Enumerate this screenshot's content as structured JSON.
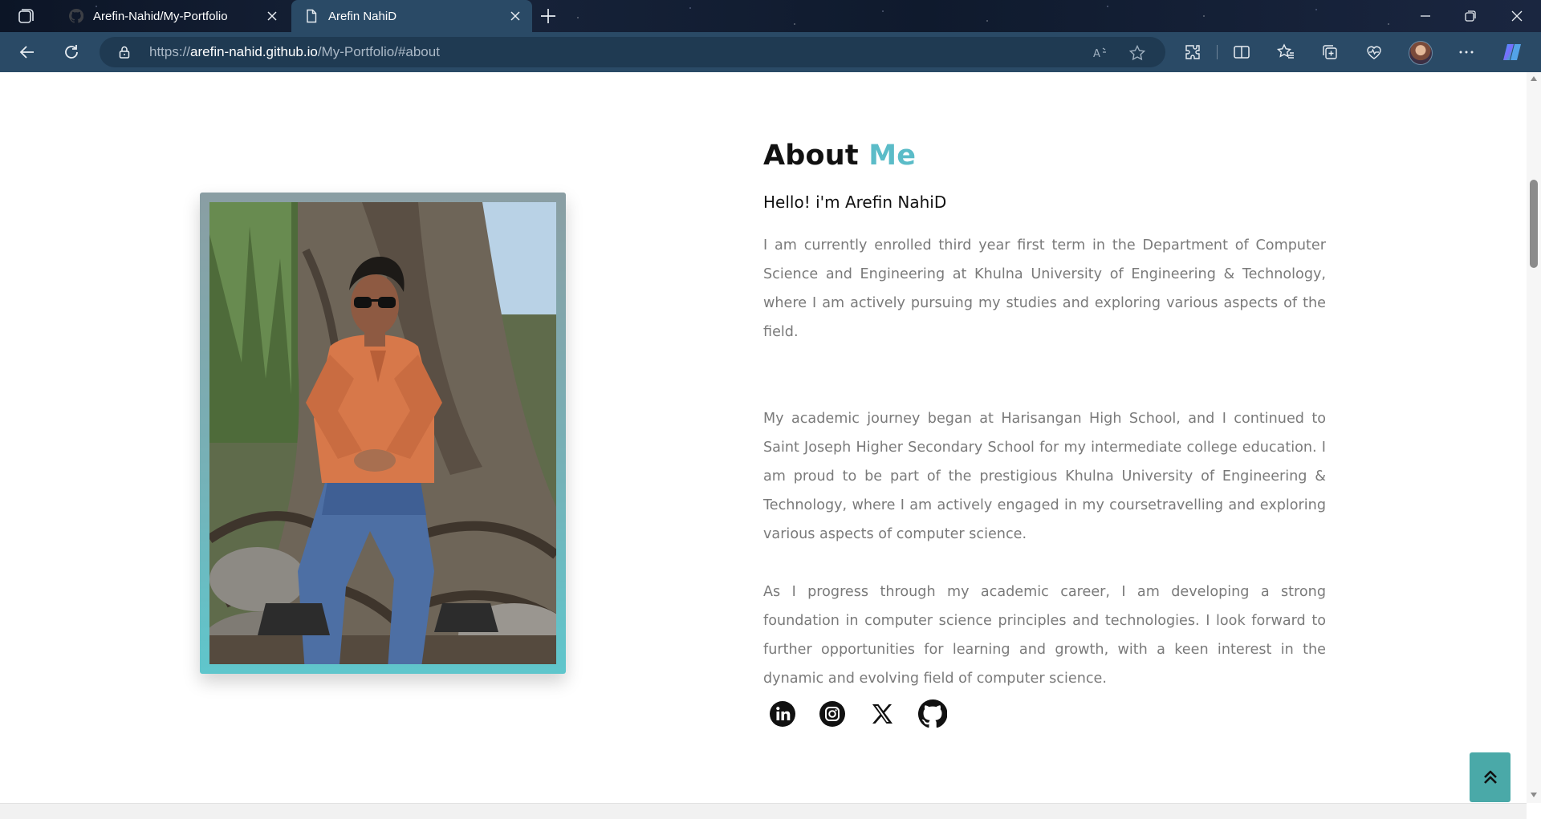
{
  "browser": {
    "tabs": [
      {
        "title": "Arefin-Nahid/My-Portfolio",
        "active": false,
        "favicon": "github-icon"
      },
      {
        "title": "Arefin NahiD",
        "active": true,
        "favicon": "page-icon"
      }
    ],
    "address": {
      "scheme": "https://",
      "host": "arefin-nahid.github.io",
      "path": "/My-Portfolio/#about"
    }
  },
  "about": {
    "title_main": "About",
    "title_accent": "Me",
    "greeting": "Hello! i'm Arefin NahiD",
    "paragraphs": [
      "I am currently enrolled third year first term in the Department of Computer Science and Engineering at Khulna University of Engineering & Technology, where I am actively pursuing my studies and exploring various aspects of the field.",
      "My academic journey began at Harisangan High School, and I continued to Saint Joseph Higher Secondary School for my intermediate college education. I am proud to be part of the prestigious Khulna University of Engineering & Technology, where I am actively engaged in my coursetravelling and exploring various aspects of computer science.",
      "As I progress through my academic career, I am developing a strong foundation in computer science principles and technologies. I look forward to further opportunities for learning and growth, with a keen interest in the dynamic and evolving field of computer science."
    ],
    "social": [
      "linkedin-icon",
      "instagram-icon",
      "x-icon",
      "github-icon"
    ]
  },
  "colors": {
    "accent": "#5bbcc8",
    "toolbar": "#2a4a66",
    "back_to_top": "#4aa9a8"
  }
}
